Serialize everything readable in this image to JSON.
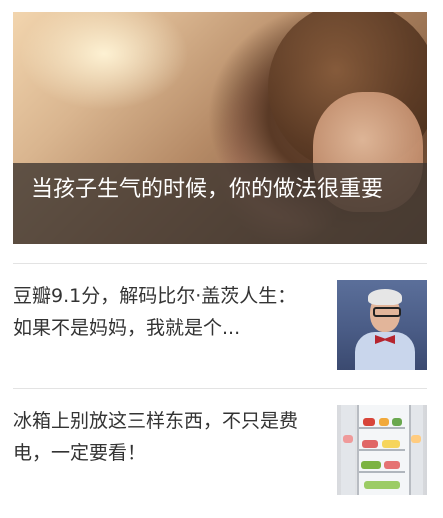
{
  "hero": {
    "title": "当孩子生气的时候，你的做法很重要"
  },
  "articles": [
    {
      "title": "豆瓣9.1分，解码比尔·盖茨人生：如果不是妈妈，我就是个...",
      "thumbnail_icon": "man-with-bowtie-thumbnail"
    },
    {
      "title": "冰箱上别放这三样东西，不只是费电，一定要看！",
      "thumbnail_icon": "open-fridge-thumbnail"
    }
  ],
  "colors": {
    "caption_overlay": "#3c3430",
    "text_primary": "#333333",
    "divider": "#e3e3e3"
  }
}
